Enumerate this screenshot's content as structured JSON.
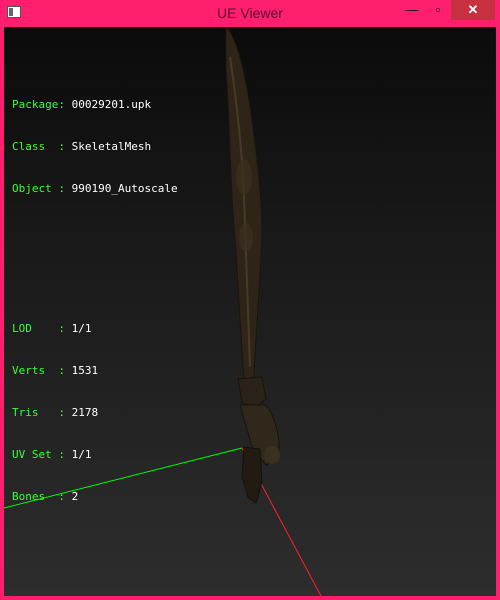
{
  "window": {
    "title": "UE Viewer"
  },
  "titlebar": {
    "minimize_label": "—",
    "maximize_label": "▫",
    "close_label": "✕"
  },
  "info": {
    "group1": [
      {
        "key": "Package:",
        "value": "00029201.upk"
      },
      {
        "key": "Class  :",
        "value": "SkeletalMesh"
      },
      {
        "key": "Object :",
        "value": "990190_Autoscale"
      }
    ],
    "group2": [
      {
        "key": "LOD    :",
        "value": "1/1"
      },
      {
        "key": "Verts  :",
        "value": "1531"
      },
      {
        "key": "Tris   :",
        "value": "2178"
      },
      {
        "key": "UV Set :",
        "value": "1/1"
      },
      {
        "key": "Bones  :",
        "value": "2"
      }
    ]
  },
  "colors": {
    "frame": "#ff1f6e",
    "info_key": "#39ff39",
    "axis_x": "#ff2020",
    "axis_z": "#00ff00"
  },
  "icons": [
    "app-icon",
    "minimize-icon",
    "maximize-icon",
    "close-icon"
  ]
}
